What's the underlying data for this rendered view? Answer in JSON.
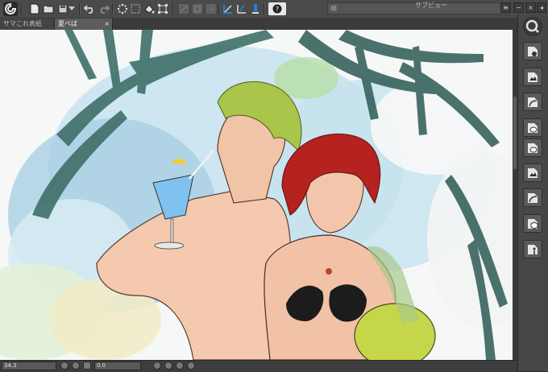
{
  "toolbar": {
    "buttons": [
      "app-logo-icon",
      "new-file-icon",
      "open-folder-icon",
      "save-icon",
      "dropdown-icon",
      "undo-icon",
      "redo-icon",
      "loading-icon",
      "clear-icon",
      "fill-icon",
      "transform-icon",
      "hide-selection-icon",
      "crop-icon",
      "ruler-icon",
      "snap-icon",
      "snap-special-icon",
      "help-icon"
    ],
    "subview_search_placeholder": "検",
    "subview_title": "サブビュー"
  },
  "tabs": [
    {
      "label": "サマこれ表紙",
      "active": false
    },
    {
      "label": "夏べば",
      "active": true
    }
  ],
  "status": {
    "zoom": "34.3",
    "angle": "0.0"
  },
  "right_panel": {
    "buttons": [
      "search-icon",
      "layer-icon",
      "image-icon",
      "curve-icon",
      "balloon-icon",
      "balloon-2-icon",
      "image-2-icon",
      "curve-2-icon",
      "cube-icon",
      "figure-icon"
    ]
  },
  "colors": {
    "chrome_dark": "#2e2e2e",
    "toolbar_bg": "#4a4a4a",
    "panel_bg": "#474747",
    "canvas_bg": "#f4f6f7",
    "accent_blue": "#2a7fd0"
  }
}
